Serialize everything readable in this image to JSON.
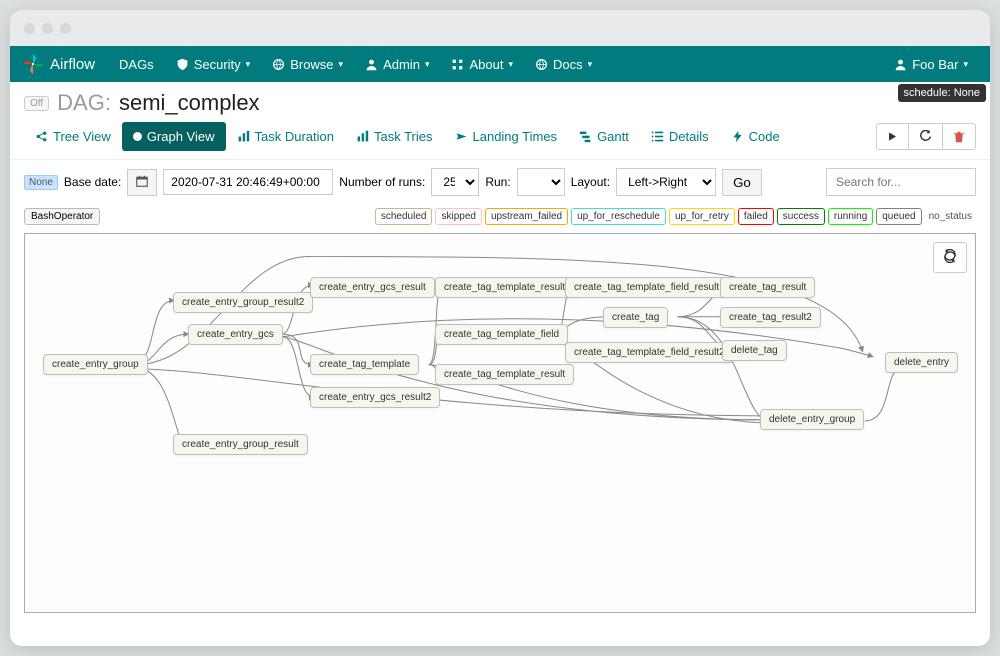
{
  "brand": "Airflow",
  "nav": {
    "dags": "DAGs",
    "security": "Security",
    "browse": "Browse",
    "admin": "Admin",
    "about": "About",
    "docs": "Docs",
    "user": "Foo Bar"
  },
  "schedule_label": "schedule: None",
  "dag": {
    "toggle": "Off",
    "prefix": "DAG:",
    "name": "semi_complex"
  },
  "tabs": {
    "tree": "Tree View",
    "graph": "Graph View",
    "duration": "Task Duration",
    "tries": "Task Tries",
    "landing": "Landing Times",
    "gantt": "Gantt",
    "details": "Details",
    "code": "Code"
  },
  "controls": {
    "none_badge": "None",
    "base_date_label": "Base date:",
    "base_date": "2020-07-31 20:46:49+00:00",
    "num_runs_label": "Number of runs:",
    "num_runs": "25",
    "run_label": "Run:",
    "run": "",
    "layout_label": "Layout:",
    "layout": "Left->Right",
    "go": "Go",
    "search_placeholder": "Search for..."
  },
  "operator": "BashOperator",
  "states": {
    "scheduled": "scheduled",
    "skipped": "skipped",
    "upstream_failed": "upstream_failed",
    "up_for_reschedule": "up_for_reschedule",
    "up_for_retry": "up_for_retry",
    "failed": "failed",
    "success": "success",
    "running": "running",
    "queued": "queued",
    "no_status": "no_status"
  },
  "state_colors": {
    "scheduled": "#d2b48c",
    "skipped": "#ffc0cb",
    "upstream_failed": "#ffa500",
    "up_for_reschedule": "#40e0d0",
    "up_for_retry": "#ffd700",
    "failed": "#ff0000",
    "success": "#008000",
    "running": "#00ff00",
    "queued": "#808080"
  },
  "nodes": {
    "create_entry_group": "create_entry_group",
    "create_entry_group_result2": "create_entry_group_result2",
    "create_entry_gcs": "create_entry_gcs",
    "create_entry_group_result": "create_entry_group_result",
    "create_entry_gcs_result": "create_entry_gcs_result",
    "create_tag_template": "create_tag_template",
    "create_entry_gcs_result2": "create_entry_gcs_result2",
    "create_tag_template_result2": "create_tag_template_result2",
    "create_tag_template_field": "create_tag_template_field",
    "create_tag_template_result": "create_tag_template_result",
    "create_tag_template_field_result": "create_tag_template_field_result",
    "create_tag": "create_tag",
    "create_tag_template_field_result2": "create_tag_template_field_result2",
    "create_tag_result": "create_tag_result",
    "create_tag_result2": "create_tag_result2",
    "delete_tag": "delete_tag",
    "delete_entry_group": "delete_entry_group",
    "delete_entry": "delete_entry"
  }
}
